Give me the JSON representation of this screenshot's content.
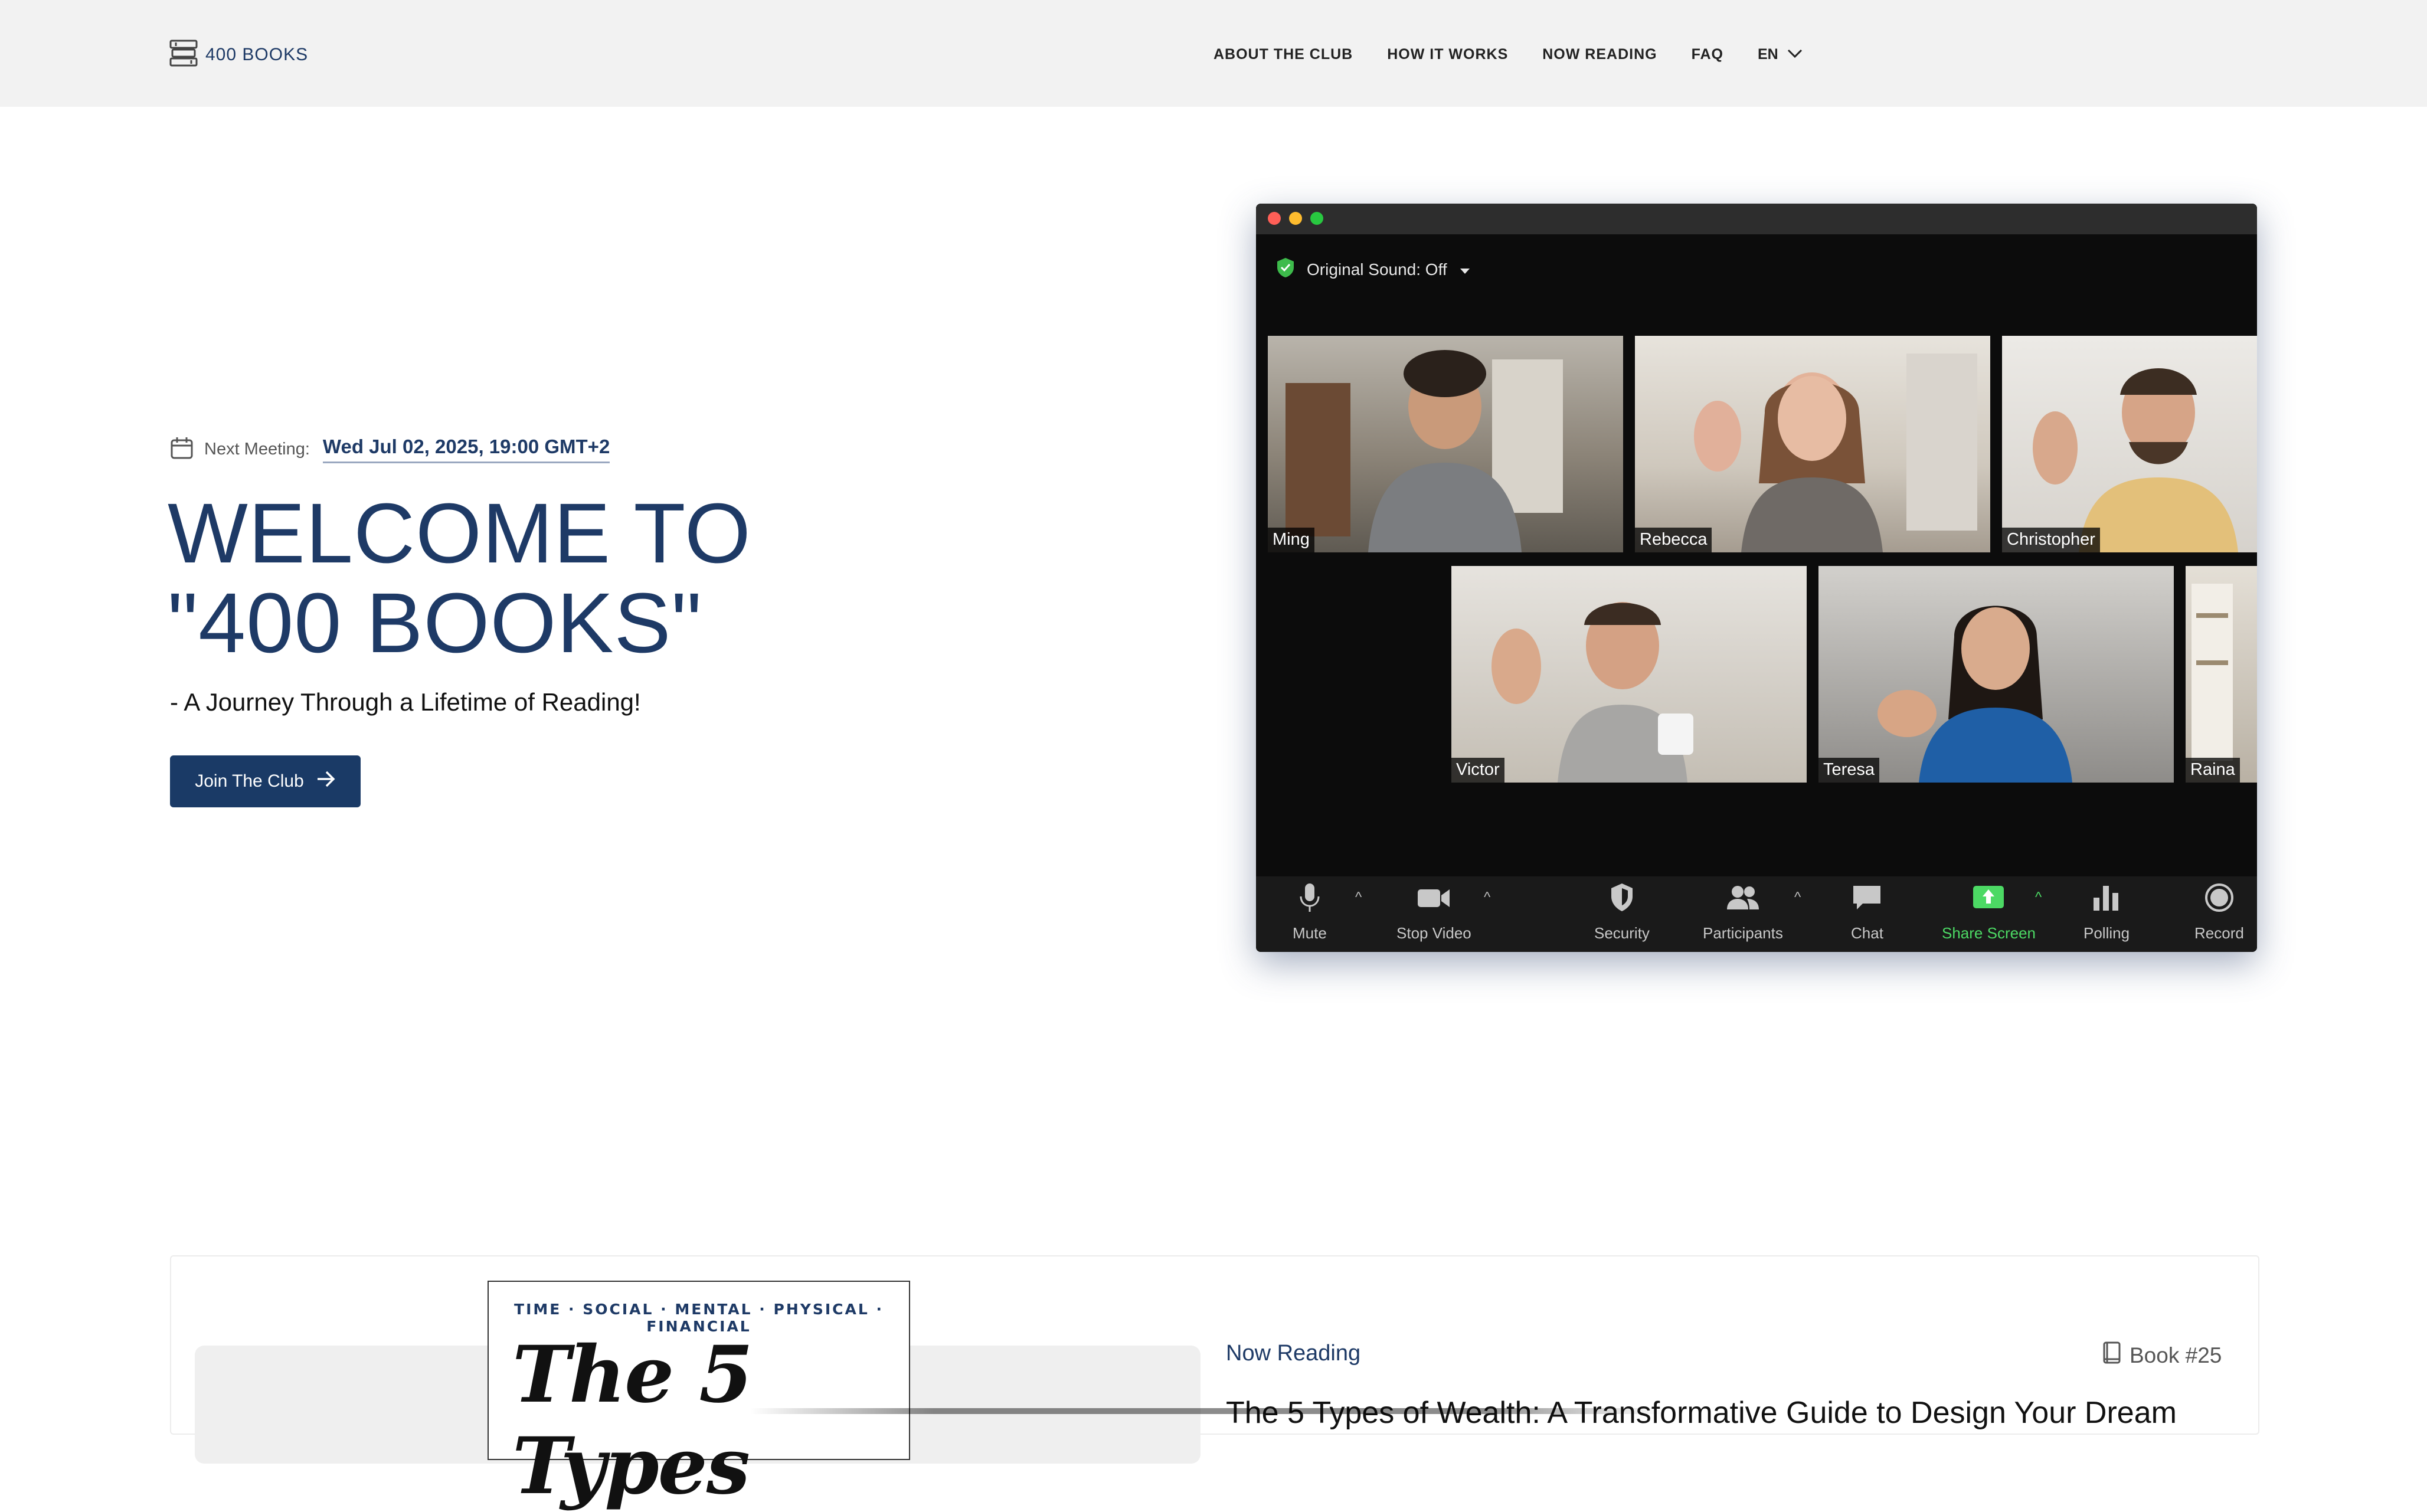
{
  "header": {
    "logo_text": "400 BOOKS",
    "nav": [
      "ABOUT THE CLUB",
      "HOW IT WORKS",
      "NOW READING",
      "FAQ"
    ],
    "language": "EN"
  },
  "hero": {
    "meeting_label": "Next Meeting:",
    "meeting_date": "Wed Jul 02, 2025, 19:00 GMT+2",
    "title": "WELCOME TO\n\"400 BOOKS\"",
    "subtitle": "- A Journey Through a Lifetime of Reading!",
    "join_button": "Join The Club"
  },
  "zoom": {
    "original_sound": "Original Sound: Off",
    "participants": [
      "Ming",
      "Rebecca",
      "Christopher",
      "Victor",
      "Teresa",
      "Raina"
    ],
    "toolbar": {
      "mute": "Mute",
      "stop_video": "Stop Video",
      "security": "Security",
      "participants": "Participants",
      "chat": "Chat",
      "share_screen": "Share Screen",
      "polling": "Polling",
      "record": "Record"
    },
    "colors": {
      "share": "#4cd964",
      "traffic_red": "#ff5f57",
      "traffic_yellow": "#febc2e",
      "traffic_green": "#28c840"
    }
  },
  "now_reading": {
    "label": "Now Reading",
    "book_number": "Book #25",
    "cover_tags": "TIME · SOCIAL · MENTAL · PHYSICAL · FINANCIAL",
    "cover_title": "The 5 Types",
    "title": "The 5 Types of Wealth: A Transformative Guide to Design Your Dream"
  },
  "colors": {
    "brand": "#1e3a66",
    "header_bg": "#f2f2f2"
  }
}
